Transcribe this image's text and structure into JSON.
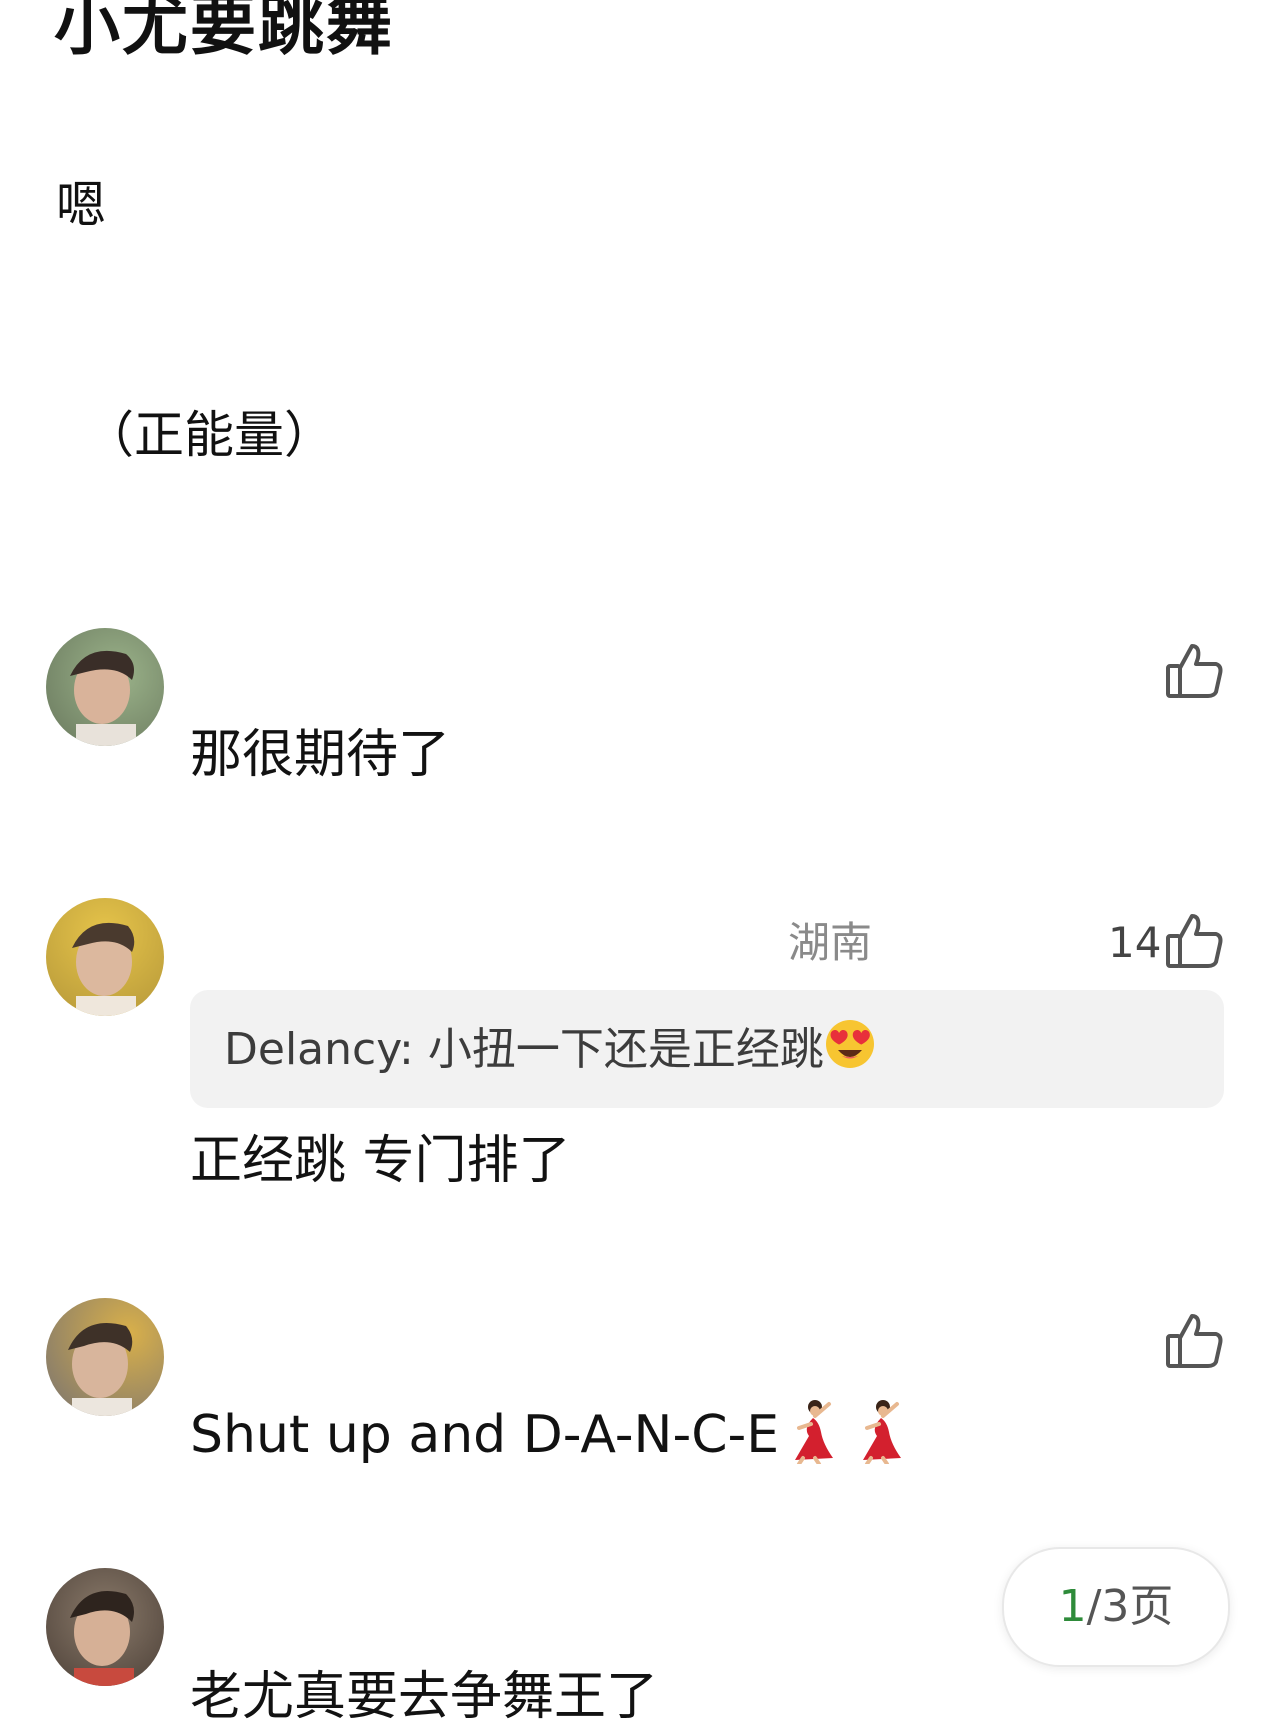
{
  "post": {
    "title": "小尤要跳舞",
    "body_line_1": "嗯",
    "body_line_2": "（正能量）"
  },
  "comments": [
    {
      "text": "那很期待了",
      "like_icon": "thumbs-up-icon"
    },
    {
      "location": "湖南",
      "like_count": "14",
      "like_icon": "thumbs-up-icon",
      "quote": "Delancy: 小扭一下还是正经跳",
      "quote_emoji": "heart-eyes-emoji",
      "text": "正经跳 专门排了"
    },
    {
      "text": "Shut up and D-A-N-C-E",
      "text_emoji": "dancer-emoji",
      "like_icon": "thumbs-up-icon"
    },
    {
      "text": "老尤真要去争舞王了"
    }
  ],
  "pager": {
    "current": "1",
    "rest": "/3页"
  },
  "colors": {
    "pager_current": "#2e8b3a",
    "quote_background": "#f2f2f2",
    "location_text": "#8a8a8a"
  }
}
